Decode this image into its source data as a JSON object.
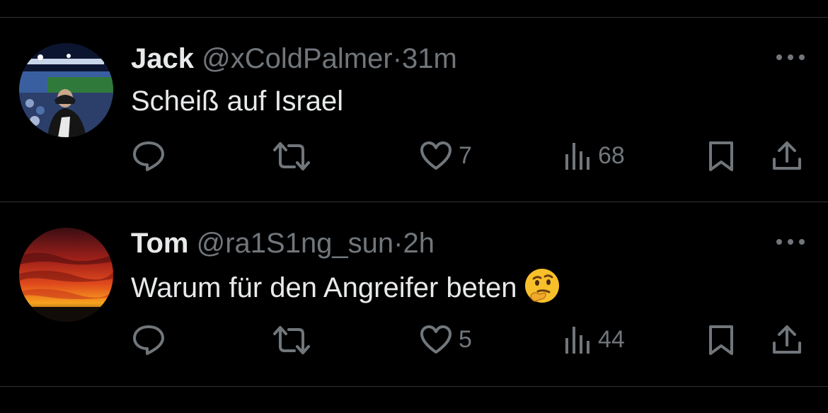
{
  "tweets": [
    {
      "display_name": "Jack",
      "handle": "@xColdPalmer",
      "separator": "·",
      "time": "31m",
      "text": "Scheiß auf Israel",
      "likes": "7",
      "views": "68"
    },
    {
      "display_name": "Tom",
      "handle": "@ra1S1ng_sun",
      "separator": "·",
      "time": "2h",
      "text": "Warum für den Angreifer beten",
      "likes": "5",
      "views": "44"
    }
  ],
  "colors": {
    "background": "#000000",
    "text_primary": "#e7e9ea",
    "text_secondary": "#71767b",
    "divider": "#2f3336"
  },
  "icons": [
    "reply-icon",
    "retweet-icon",
    "like-icon",
    "views-icon",
    "bookmark-icon",
    "share-icon",
    "more-icon",
    "thinking-face-emoji"
  ]
}
